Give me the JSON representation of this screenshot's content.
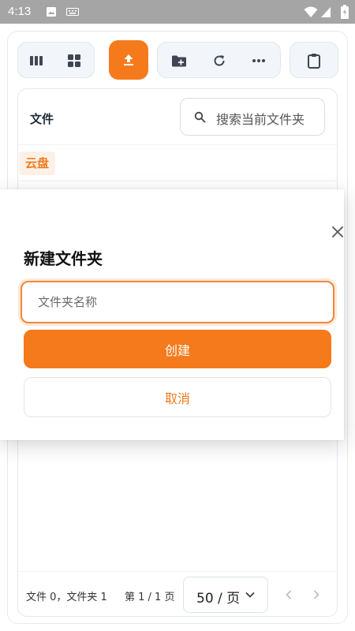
{
  "status_bar": {
    "time": "4:13"
  },
  "toolbar": {
    "column_view_icon": "columns-icon",
    "grid_view_icon": "grid-icon",
    "upload_icon": "upload-icon",
    "new_folder_icon": "folder-plus-icon",
    "refresh_icon": "refresh-icon",
    "more_icon": "more-icon",
    "clipboard_icon": "clipboard-icon"
  },
  "file_list": {
    "column_title": "文件",
    "search_placeholder": "搜索当前文件夹",
    "root_label": "云盘"
  },
  "footer": {
    "counts": "文件 0，文件夹 1",
    "page_info": "第 1 / 1 页",
    "page_size": "50 / 页"
  },
  "dialog": {
    "title": "新建文件夹",
    "input_placeholder": "文件夹名称",
    "input_value": "",
    "create_label": "创建",
    "cancel_label": "取消"
  },
  "colors": {
    "accent": "#f57a1c",
    "status_bar": "#a5a5a5"
  }
}
